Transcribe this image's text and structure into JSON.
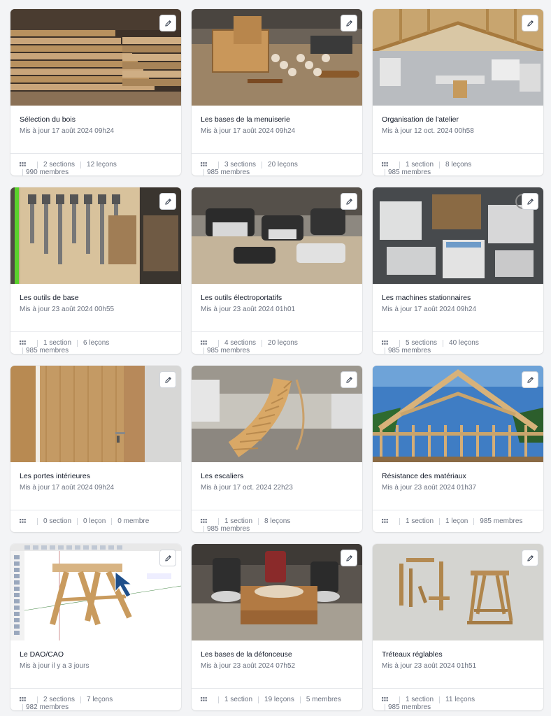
{
  "courses": [
    {
      "title": "Sélection du bois",
      "updated": "Mis à jour 17 août 2024 09h24",
      "sections": "2 sections",
      "lessons": "12 leçons",
      "members": "990 membres",
      "wrap": true,
      "image": "lumber-stack"
    },
    {
      "title": "Les bases de la menuiserie",
      "updated": "Mis à jour 17 août 2024 09h24",
      "sections": "3 sections",
      "lessons": "20 leçons",
      "members": "985 membres",
      "wrap": true,
      "image": "workbench-joinery"
    },
    {
      "title": "Organisation de l'atelier",
      "updated": "Mis à jour 12 oct. 2024 00h58",
      "sections": "1 section",
      "lessons": "8 leçons",
      "members": "985 membres",
      "wrap": true,
      "image": "workshop-interior"
    },
    {
      "title": "Les outils de base",
      "updated": "Mis à jour 23 août 2024 00h55",
      "sections": "1 section",
      "lessons": "6 leçons",
      "members": "985 membres",
      "wrap": true,
      "image": "tool-wall"
    },
    {
      "title": "Les outils électroportatifs",
      "updated": "Mis à jour 23 août 2024 01h01",
      "sections": "4 sections",
      "lessons": "20 leçons",
      "members": "985 membres",
      "wrap": true,
      "image": "power-tools"
    },
    {
      "title": "Les machines stationnaires",
      "updated": "Mis à jour 17 août 2024 09h24",
      "sections": "5 sections",
      "lessons": "40 leçons",
      "members": "985 membres",
      "wrap": true,
      "image": "stationary-machines"
    },
    {
      "title": "Les portes intérieures",
      "updated": "Mis à jour 17 août 2024 09h24",
      "sections": "0 section",
      "lessons": "0 leçon",
      "members": "0 membre",
      "wrap": false,
      "image": "interior-door"
    },
    {
      "title": "Les escaliers",
      "updated": "Mis à jour 17 oct. 2024 22h23",
      "sections": "1 section",
      "lessons": "8 leçons",
      "members": "985 membres",
      "wrap": true,
      "image": "staircase"
    },
    {
      "title": "Résistance des matériaux",
      "updated": "Mis à jour 23 août 2024 01h37",
      "sections": "1 section",
      "lessons": "1 leçon",
      "members": "985 membres",
      "wrap": false,
      "image": "timber-frame"
    },
    {
      "title": "Le DAO/CAO",
      "updated": "Mis à jour il y a 3 jours",
      "sections": "2 sections",
      "lessons": "7 leçons",
      "members": "982 membres",
      "wrap": true,
      "image": "cad-sawhorse"
    },
    {
      "title": "Les bases de la défonceuse",
      "updated": "Mis à jour 23 août 2024 07h52",
      "sections": "1 section",
      "lessons": "19 leçons",
      "members": "5 membres",
      "wrap": false,
      "image": "router-box"
    },
    {
      "title": "Tréteaux réglables",
      "updated": "Mis à jour 23 août 2024 01h51",
      "sections": "1 section",
      "lessons": "11 leçons",
      "members": "985 membres",
      "wrap": true,
      "image": "sawhorse-model"
    }
  ],
  "icons": {
    "edit": "pencil-icon",
    "drag": "grip-icon"
  },
  "colors": {
    "background": "#f3f4f6",
    "card": "#ffffff",
    "muted": "#6b7280",
    "border": "#e5e7eb"
  }
}
